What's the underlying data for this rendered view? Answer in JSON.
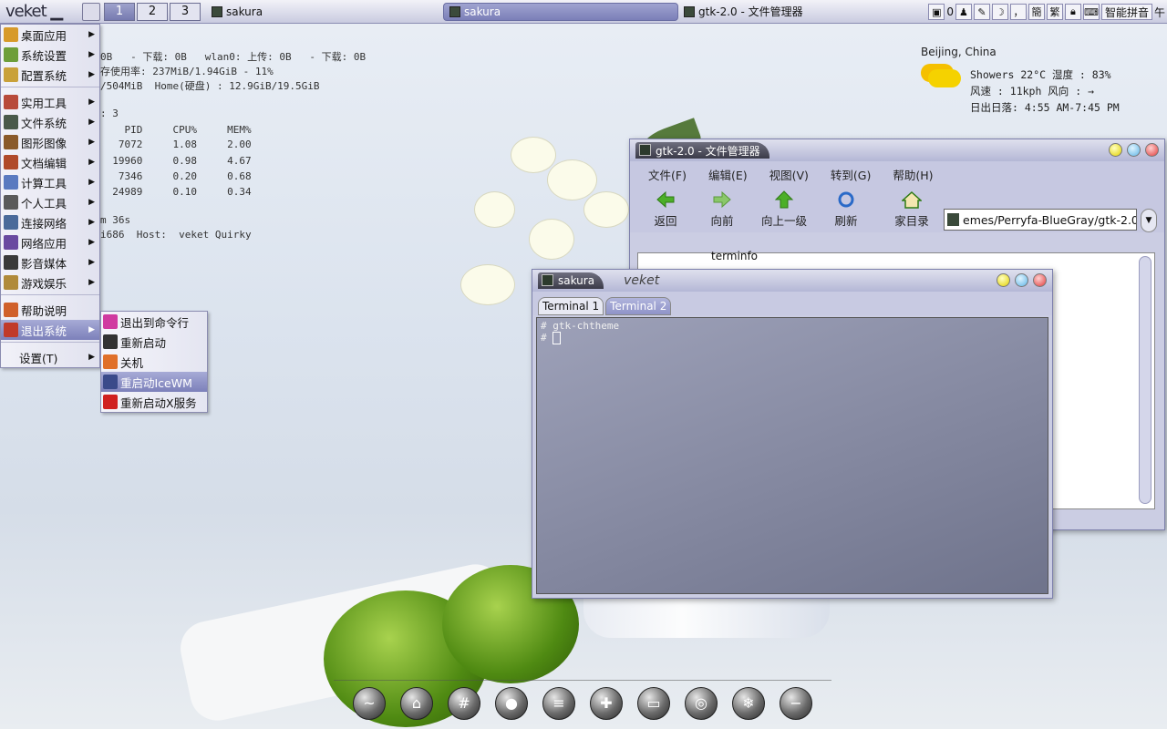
{
  "taskbar": {
    "logo": "veket",
    "workspaces": [
      "1",
      "2",
      "3"
    ],
    "tasks": [
      {
        "label": "sakura",
        "active": false
      },
      {
        "label": "sakura",
        "active": true
      },
      {
        "label": "gtk-2.0 - 文件管理器",
        "active": false
      }
    ],
    "tray": {
      "clock_left": "0",
      "ime_fan": "繁",
      "ime_simp": "簡",
      "ime_name": "智能拼音",
      "clock": "午"
    }
  },
  "conky": {
    "line1": "0B   - 下载: 0B   wlan0: 上传: 0B   - 下载: 0B",
    "line2": "存使用率: 237MiB/1.94GiB - 11%",
    "line3": "/504MiB  Home(硬盘) : 12.9GiB/19.5GiB",
    "line4": ": 3",
    "header": "    PID     CPU%     MEM%",
    "rows": [
      "   7072     1.08     2.00",
      "  19960     0.98     4.67",
      "   7346     0.20     0.68",
      "  24989     0.10     0.34"
    ],
    "line5": "m 36s",
    "line6": "i686  Host:  veket Quirky"
  },
  "menu": {
    "items": [
      {
        "label": "桌面应用",
        "sub": true,
        "color": "#d79a2a"
      },
      {
        "label": "系统设置",
        "sub": true,
        "color": "#6e9e3a"
      },
      {
        "label": "配置系统",
        "sub": true,
        "color": "#c9a13a"
      },
      {
        "label": "实用工具",
        "sub": true,
        "color": "#b84a3a"
      },
      {
        "label": "文件系统",
        "sub": true,
        "color": "#4a5a4a"
      },
      {
        "label": "图形图像",
        "sub": true,
        "color": "#8a5a2a"
      },
      {
        "label": "文档编辑",
        "sub": true,
        "color": "#b04a2a"
      },
      {
        "label": "计算工具",
        "sub": true,
        "color": "#5a7ac0"
      },
      {
        "label": "个人工具",
        "sub": true,
        "color": "#5a5a5a"
      },
      {
        "label": "连接网络",
        "sub": true,
        "color": "#4a6a9a"
      },
      {
        "label": "网络应用",
        "sub": true,
        "color": "#6a4aa0"
      },
      {
        "label": "影音媒体",
        "sub": true,
        "color": "#3a3a3a"
      },
      {
        "label": "游戏娱乐",
        "sub": true,
        "color": "#b08a3a"
      },
      {
        "label": "帮助说明",
        "sub": false,
        "color": "#d0602a"
      },
      {
        "label": "退出系统",
        "sub": true,
        "color": "#c03a2a",
        "selected": true
      }
    ],
    "settings": "设置(T)"
  },
  "submenu": {
    "items": [
      {
        "label": "退出到命令行",
        "color": "#d03aa0"
      },
      {
        "label": "重新启动",
        "color": "#333333"
      },
      {
        "label": "关机",
        "color": "#e0702a"
      },
      {
        "label": "重启动IceWM",
        "color": "#3a4a8a",
        "selected": true
      },
      {
        "label": "重新启动X服务",
        "color": "#d02020"
      }
    ]
  },
  "weather": {
    "city": "Beijing, China",
    "line1": "Showers  22°C  湿度 : 83%",
    "line2": "风速 : 11kph  风向 : →",
    "line3": "日出日落: 4:55 AM-7:45 PM"
  },
  "file_manager": {
    "title": "gtk-2.0 - 文件管理器",
    "menus": [
      "文件(F)",
      "编辑(E)",
      "视图(V)",
      "转到(G)",
      "帮助(H)"
    ],
    "tools": [
      "返回",
      "向前",
      "向上一级",
      "刷新",
      "家目录"
    ],
    "location": "emes/Perryfa-BlueGray/gtk-2.0",
    "tree_item": "terminfo"
  },
  "terminal": {
    "title": "sakura",
    "subtitle": "veket",
    "tabs": [
      "Terminal 1",
      "Terminal 2"
    ],
    "line1": "# gtk-chtheme",
    "prompt": "# "
  },
  "dock": [
    "~",
    "⌂",
    "#",
    "●",
    "≡",
    "✚",
    "▭",
    "◎",
    "❄",
    "−"
  ]
}
